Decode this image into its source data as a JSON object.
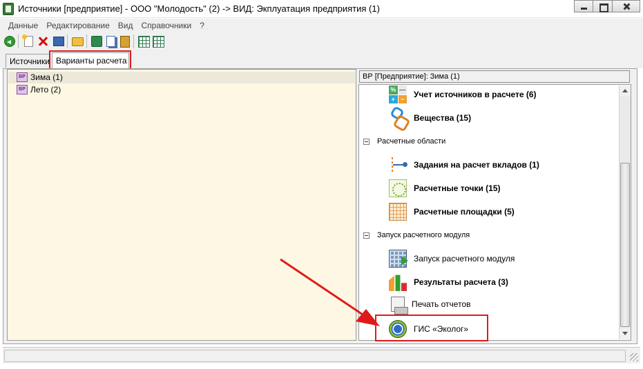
{
  "window": {
    "title": "Источники [предприятие] - ООО \"Молодость\" (2) -> ВИД: Экплуатация предприятия (1)",
    "controls": [
      "minimize",
      "maximize",
      "close"
    ]
  },
  "menu": {
    "items": [
      "Данные",
      "Редактирование",
      "Вид",
      "Справочники",
      "?"
    ]
  },
  "toolbar": {
    "icons": [
      "back-icon",
      "new-document-icon",
      "delete-icon",
      "edit-icon",
      "open-folder-icon",
      "refresh-icon",
      "copy-icon",
      "calculator-icon",
      "grid-export-icon",
      "grid-import-icon"
    ]
  },
  "tabs": [
    {
      "label": "Источники",
      "active": false
    },
    {
      "label": "Варианты расчета",
      "active": true
    }
  ],
  "left_tree": {
    "items": [
      {
        "icon": "bp",
        "icon_text": "BP",
        "label": "Зима (1)",
        "selected": true
      },
      {
        "icon": "bp",
        "icon_text": "BP",
        "label": "Лето (2)",
        "selected": false
      }
    ]
  },
  "right_panel": {
    "header": "ВР [Предприятие]: Зима (1)",
    "items": [
      {
        "label": "Учет источников в расчете (6)",
        "bold": true,
        "icon": "sources-calc-icon",
        "icon_symbols": [
          "%",
          "—",
          "+",
          "−"
        ]
      },
      {
        "label": "Вещества (15)",
        "bold": true,
        "icon": "substances-icon"
      },
      {
        "section": "Расчетные области"
      },
      {
        "label": "Задания на расчет вкладов (1)",
        "bold": true,
        "icon": "tasks-icon"
      },
      {
        "label": "Расчетные точки (15)",
        "bold": true,
        "icon": "calc-points-icon"
      },
      {
        "label": "Расчетные площадки (5)",
        "bold": true,
        "icon": "calc-areas-icon"
      },
      {
        "section": "Запуск расчетного модуля"
      },
      {
        "label": "Запуск расчетного модуля",
        "bold": false,
        "icon": "run-module-icon"
      },
      {
        "label": "Результаты расчета (3)",
        "bold": true,
        "icon": "results-icon"
      },
      {
        "label": "Печать отчетов",
        "bold": false,
        "icon": "print-reports-icon"
      },
      {
        "label": "ГИС «Эколог»",
        "bold": false,
        "icon": "gis-ecolog-icon"
      }
    ]
  },
  "colors": {
    "left_panel_bg": "#fdf7e3",
    "annotation_red": "#e01a1a"
  }
}
